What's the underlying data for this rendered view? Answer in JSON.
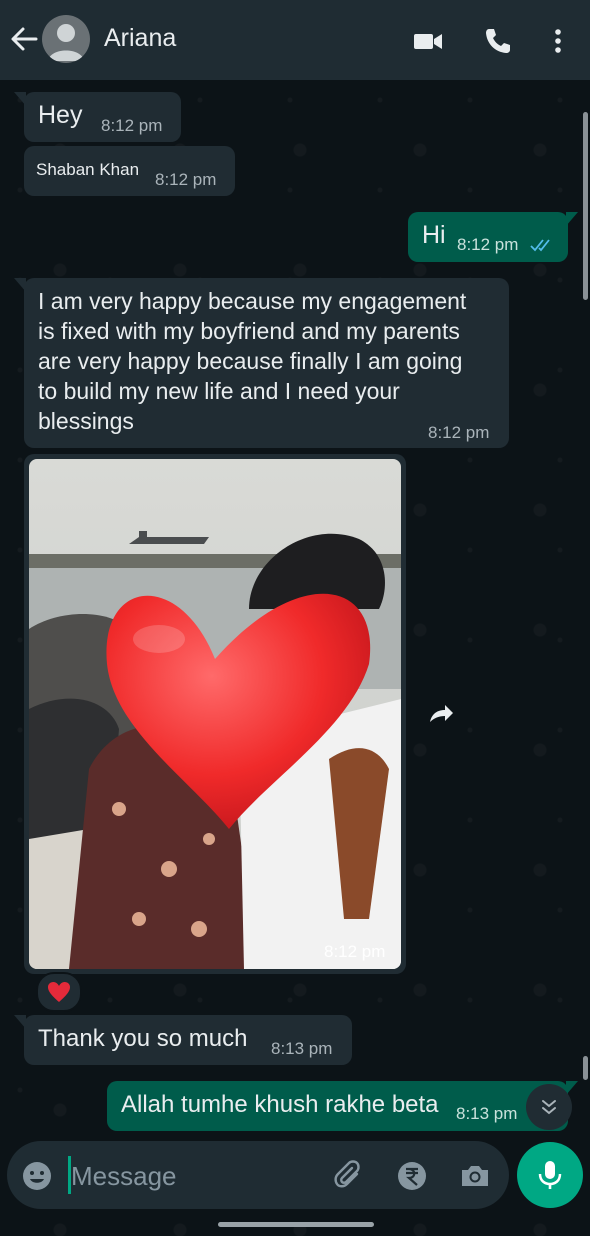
{
  "header": {
    "contact_name": "Ariana",
    "icons": [
      "back-arrow-icon",
      "avatar",
      "video-call-icon",
      "voice-call-icon",
      "more-options-icon"
    ]
  },
  "messages": [
    {
      "direction": "in",
      "text": "Hey",
      "time": "8:12 pm"
    },
    {
      "direction": "in",
      "text": "Shaban Khan",
      "time": "8:12 pm"
    },
    {
      "direction": "out",
      "text": "Hi",
      "time": "8:12 pm",
      "status": "read"
    },
    {
      "direction": "in",
      "text_lines": [
        "I am very happy because my engagement",
        "is fixed with my boyfriend and my parents",
        "are very happy because finally I am going",
        "to build my new life and I need your",
        "blessings"
      ],
      "time": "8:12 pm"
    },
    {
      "direction": "in",
      "type": "photo",
      "time": "8:12 pm",
      "reaction": "❤️"
    },
    {
      "direction": "in",
      "text": "Thank you so much",
      "time": "8:13 pm"
    },
    {
      "direction": "out",
      "text": "Allah tumhe khush rakhe beta",
      "time": "8:13 pm"
    }
  ],
  "composer": {
    "placeholder": "Message",
    "icons": [
      "emoji-icon",
      "attach-icon",
      "rupee-payment-icon",
      "camera-icon",
      "mic-icon"
    ]
  },
  "colors": {
    "header_bg": "#1f2c33",
    "incoming_bubble": "#202c33",
    "outgoing_bubble": "#005c4b",
    "accent": "#00a884",
    "read_ticks": "#53bdeb"
  }
}
